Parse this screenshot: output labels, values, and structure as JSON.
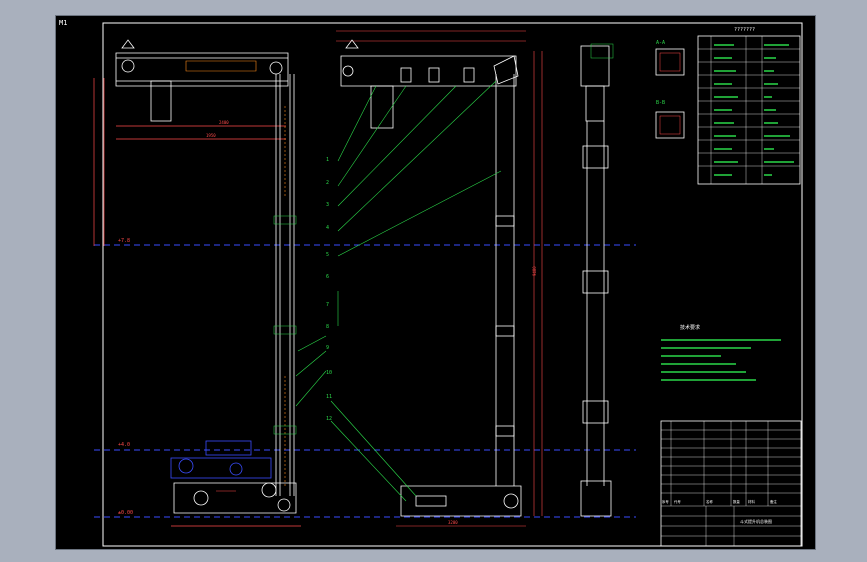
{
  "viewport": {
    "corner_label": "M1",
    "background": "#000000",
    "frame_color": "#ffffff",
    "centerline_color": "#3a4dff"
  },
  "title_block": {
    "top_caption": "???????"
  },
  "callouts": [
    "1",
    "2",
    "3",
    "4",
    "5",
    "6",
    "7",
    "8",
    "9",
    "10",
    "11",
    "12"
  ],
  "elevation_marks": {
    "top": "+7.8",
    "mid": "+4.0",
    "bottom": "±0.00"
  },
  "dimensions": {
    "width_left": "2400",
    "width_mid": "3200",
    "height_left": "1950",
    "vertical_total": "9480"
  },
  "section_labels": {
    "a": "A-A",
    "b": "B-B"
  },
  "notes_title": "技术要求",
  "bom_headers": [
    "序号",
    "代号",
    "名称",
    "数量",
    "材料",
    "备注"
  ],
  "bottom_title": "斗式提升机总装图"
}
